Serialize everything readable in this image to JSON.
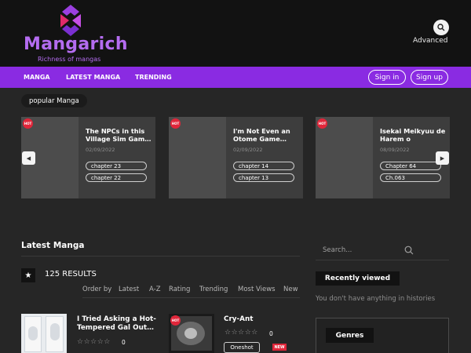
{
  "brand": {
    "name": "Mangarich",
    "tagline": "Richness of mangas",
    "colors": {
      "accent": "#8a2be2",
      "logo": "#b46cf0",
      "hot": "#e0263a"
    }
  },
  "header": {
    "advanced_label": "Advanced",
    "search_icon": "search-icon"
  },
  "nav": {
    "items": [
      "MANGA",
      "LATEST MANGA",
      "TRENDING"
    ],
    "sign_in": "Sign in",
    "sign_up": "Sign up"
  },
  "popular": {
    "title": "popular Manga",
    "hot_label": "HOT",
    "cards": [
      {
        "title_line1": "The NPCs in this",
        "title_line2": "Village Sim Gam…",
        "date": "02/09/2022",
        "chapters": [
          "chapter 23",
          "chapter 22"
        ]
      },
      {
        "title_line1": "I'm Not Even an",
        "title_line2": "Otome Game…",
        "date": "02/09/2022",
        "chapters": [
          "chapter 14",
          "chapter 13"
        ]
      },
      {
        "title_line1": "Isekai Meikyuu de",
        "title_line2": "Harem o",
        "date": "08/09/2022",
        "chapters": [
          "Chapter 64",
          "Ch.063"
        ]
      }
    ]
  },
  "latest": {
    "title": "Latest Manga",
    "results": "125 RESULTS",
    "order_items": [
      "Order by",
      "Latest",
      "A-Z",
      "Rating",
      "Trending",
      "Most Views",
      "New"
    ],
    "items": [
      {
        "title_line1": "I Tried Asking a Hot-",
        "title_line2": "Tempered Gal Out…",
        "stars": "☆☆☆☆☆",
        "rating": "0"
      },
      {
        "title_line1": "Cry-Ant",
        "title_line2": "",
        "stars": "☆☆☆☆☆",
        "rating": "0",
        "badge": "Oneshot",
        "new_label": "NEW"
      }
    ]
  },
  "sidebar": {
    "search_placeholder": "Search...",
    "recently_viewed": "Recently viewed",
    "recently_empty": "You don't have anything in histories",
    "genres": "Genres"
  }
}
